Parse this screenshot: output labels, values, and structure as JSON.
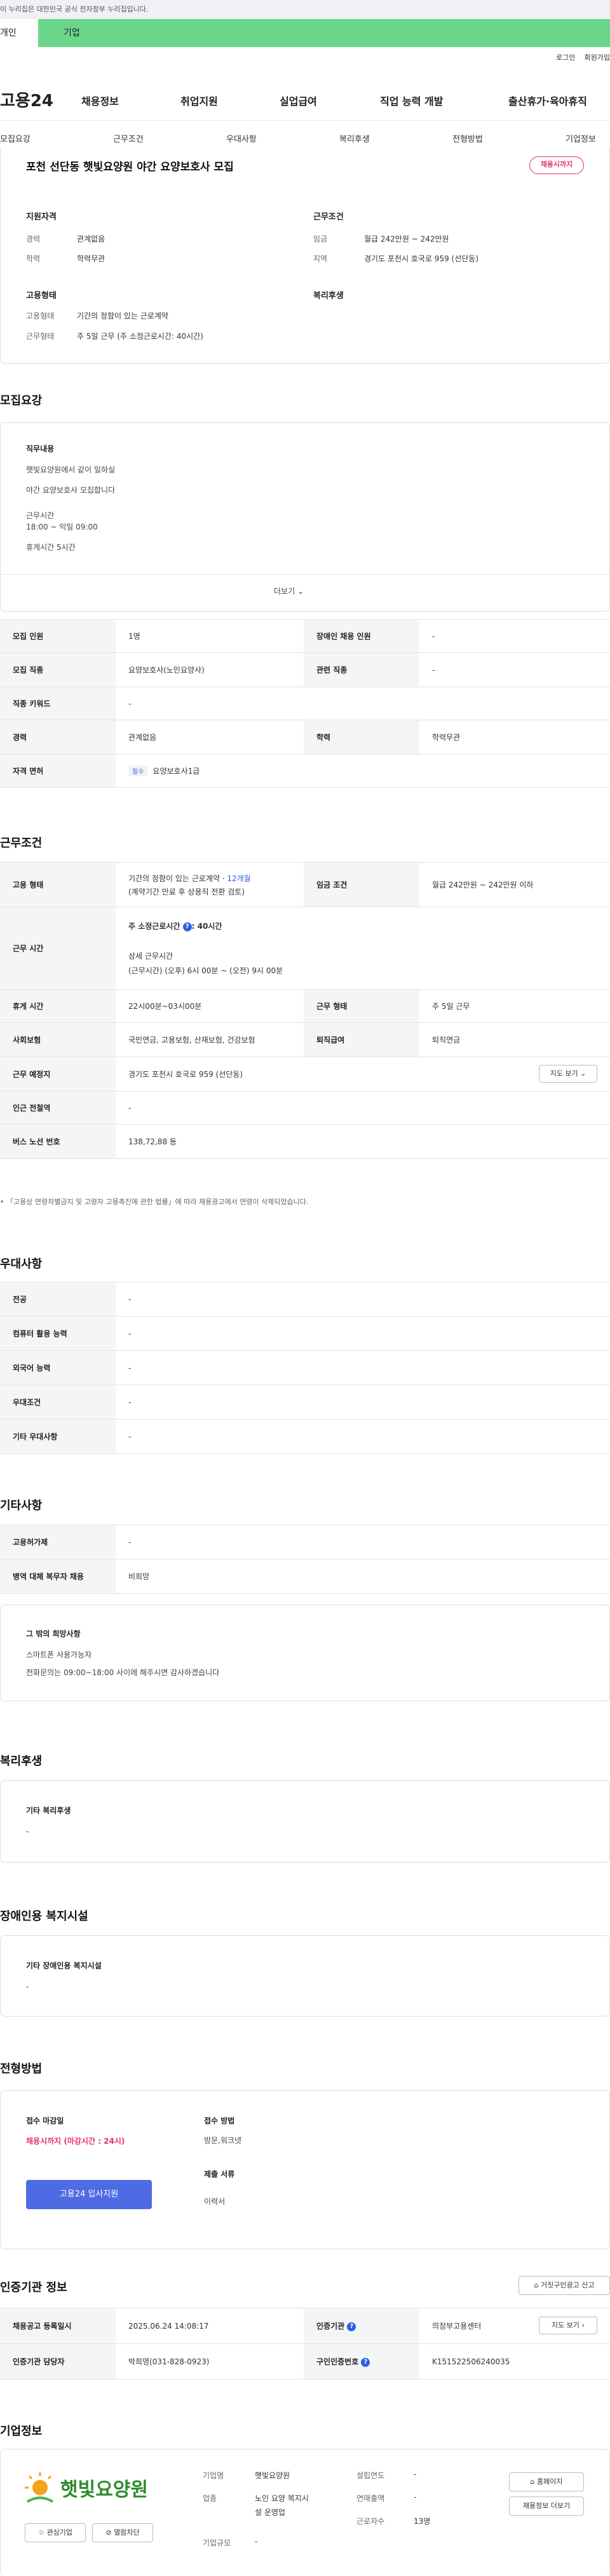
{
  "gov_banner": "이 누리집은 대한민국 공식 전자정부 누리집입니다.",
  "usertabs": [
    "개인",
    "기업"
  ],
  "util": [
    "로그인",
    "회원가입"
  ],
  "logo": "고용24",
  "gnb": [
    "채용정보",
    "취업지원",
    "실업급여",
    "직업 능력 개발",
    "출산휴가·육아휴직"
  ],
  "snb": [
    "모집요강",
    "근무조건",
    "우대사항",
    "복리후생",
    "전형방법",
    "기업정보"
  ],
  "job": {
    "title": "포천 선단동 햇빛요양원 야간 요양보호사 모집",
    "badge": "채용시까지",
    "qual_title": "지원자격",
    "exp_label": "경력",
    "exp": "관계없음",
    "edu_label": "학력",
    "edu": "학력무관",
    "cond_title": "근무조건",
    "wage_label": "임금",
    "wage": "월급 242만원 ~ 242만원",
    "area_label": "지역",
    "area": "경기도 포천시 호국로 959 (선단동)",
    "emp_title": "고용형태",
    "emptype_label": "고용형태",
    "emptype": "기간의 정함이 있는 근로계약",
    "worktype_label": "근무형태",
    "worktype": "주 5일 근무 (주 소정근로시간: 40시간)",
    "welfare_title": "복리후생"
  },
  "recruit": {
    "title": "모집요강",
    "duty_title": "직무내용",
    "duty_lines": [
      "햇빛요양원에서 같이 일하실",
      "야간 요양보호사 모집합니다",
      "",
      "근무시간",
      "18:00 ~ 익일 09:00",
      "",
      "휴게시간 5시간"
    ],
    "more": "더보기",
    "rows": [
      [
        "모집 인원",
        "1명",
        "장애인 채용 인원",
        "-"
      ],
      [
        "모집 직종",
        "요양보호사(노인요양사)",
        "관련 직종",
        "-"
      ],
      [
        "직종 키워드",
        "-"
      ],
      [
        "경력",
        "관계없음",
        "학력",
        "학력무관"
      ],
      [
        "자격 면허",
        "필수",
        "요양보호사1급"
      ]
    ]
  },
  "cond": {
    "title": "근무조건",
    "emp_label": "고용 형태",
    "emp_l1a": "기간의 정함이 있는 근로계약 · ",
    "emp_l1b": "12개월",
    "emp_l2": "(계약기간 만료 후 상용직 전환 검토)",
    "wage_label": "임금 조건",
    "wage": "월급 242만원 ~ 242만원 이하",
    "time_label": "근무 시간",
    "time_head": "주 소정근로시간",
    "time_hours": ": 40시간",
    "time_detail_title": "상세 근무시간",
    "time_detail": "(근무시간) (오후) 6시 00분 ~ (오전) 9시 00분",
    "rest_label": "휴게 시간",
    "rest": "22시00분~03시00분",
    "form_label": "근무 형태",
    "form": "주 5일 근무",
    "ins_label": "사회보험",
    "ins": "국민연금, 고용보험, 산재보험, 건강보험",
    "sev_label": "퇴직급여",
    "sev": "퇴직연금",
    "place_label": "근무 예정지",
    "place": "경기도 포천시 호국로 959 (선단동)",
    "map": "지도 보기",
    "subway_label": "인근 전철역",
    "subway": "-",
    "bus_label": "버스 노선 번호",
    "bus": "138,72,88 등",
    "note": "「고용상 연령차별금지 및 고령자 고용촉진에 관한 법률」에 따라 채용광고에서 연령이 삭제되었습니다."
  },
  "pref": {
    "title": "우대사항",
    "rows": [
      [
        "전공",
        "-"
      ],
      [
        "컴퓨터 활용 능력",
        "-"
      ],
      [
        "외국어 능력",
        "-"
      ],
      [
        "우대조건",
        "-"
      ],
      [
        "기타 우대사항",
        "-"
      ]
    ]
  },
  "etc": {
    "title": "기타사항",
    "rows": [
      [
        "고용허가제",
        "-"
      ],
      [
        "병역 대체 복무자 채용",
        "비희망"
      ]
    ],
    "hope_title": "그 밖의 희망사항",
    "hope_lines": [
      "스마트폰 사용가능자",
      "전화문의는 09:00~18:00 사이에 해주시면 감사하겠습니다"
    ]
  },
  "welfare": {
    "title": "복리후생",
    "sub": "기타 복리후생",
    "val": "-"
  },
  "disab": {
    "title": "장애인용 복지시설",
    "sub": "기타 장애인용 복지시설",
    "val": "-"
  },
  "screen": {
    "title": "전형방법",
    "deadline_title": "접수 마감일",
    "deadline": "채용시까지 (마감시간 : 24시)",
    "apply_btn": "고용24 입사지원",
    "method_title": "접수 방법",
    "method": "방문,워크넷",
    "docs_title": "제출 서류",
    "docs": "이력서"
  },
  "cert": {
    "title": "인증기관 정보",
    "report": "거짓구인광고 신고",
    "reg_label": "채용공고 등록일시",
    "reg": "2025.06.24 14:08:17",
    "org_label": "인증기관",
    "org": "의정부고용센터",
    "map": "지도 보기",
    "mgr_label": "인증기관 담당자",
    "mgr": "박희영(031-828-0923)",
    "no_label": "구인인증번호",
    "no": "K151522506240035"
  },
  "company": {
    "title": "기업정보",
    "logo_text": "햇빛요양원",
    "fav": "관심기업",
    "block": "열람차단",
    "name_label": "기업명",
    "name": "햇빛요양원",
    "industry_label": "업종",
    "industry_l1": "노인 요양 복지시",
    "industry_l2": "설 운영업",
    "size_label": "기업규모",
    "size": "-",
    "founded_label": "설립연도",
    "founded": "-",
    "sales_label": "연매출액",
    "sales": "-",
    "emp_label": "근로자수",
    "emp": "13명",
    "home": "홈페이지",
    "jobs": "채용정보 더보기"
  }
}
